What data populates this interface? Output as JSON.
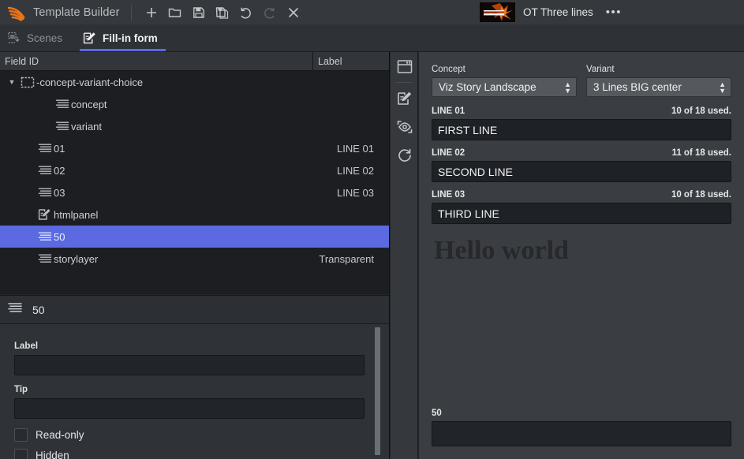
{
  "titlebar": {
    "logo_icon": "vizrt-swoosh-logo",
    "app_title": "Template Builder",
    "buttons": [
      {
        "name": "new",
        "icon": "plus-icon",
        "label": "+",
        "disabled": false
      },
      {
        "name": "open",
        "icon": "folder-open-icon",
        "label": "",
        "disabled": false
      },
      {
        "name": "save",
        "icon": "save-icon",
        "label": "",
        "disabled": false
      },
      {
        "name": "save-as",
        "icon": "save-as-icon",
        "label": "",
        "disabled": false
      },
      {
        "name": "undo",
        "icon": "undo-icon",
        "label": "",
        "disabled": false
      },
      {
        "name": "redo",
        "icon": "redo-icon",
        "label": "",
        "disabled": true
      },
      {
        "name": "close",
        "icon": "close-icon",
        "label": "",
        "disabled": false
      }
    ],
    "document": {
      "thumbnail_icon": "template-thumbnail",
      "name": "OT Three lines",
      "overflow_menu": "•••"
    }
  },
  "tabs": [
    {
      "id": "scenes",
      "label": "Scenes",
      "icon": "scenes-icon",
      "active": false
    },
    {
      "id": "fill-in-form",
      "label": "Fill-in form",
      "icon": "form-edit-icon",
      "active": true
    }
  ],
  "tree": {
    "columns": {
      "field_id": "Field ID",
      "label": "Label"
    },
    "rows": [
      {
        "name": "-concept-variant-choice",
        "label": "",
        "icon": "dashed-box-icon",
        "indent": 0,
        "twisty": "▼",
        "selected": false
      },
      {
        "name": "concept",
        "label": "",
        "icon": "text-lines-icon",
        "indent": 2,
        "twisty": "",
        "selected": false
      },
      {
        "name": "variant",
        "label": "",
        "icon": "text-lines-icon",
        "indent": 2,
        "twisty": "",
        "selected": false
      },
      {
        "name": "01",
        "label": "LINE 01",
        "icon": "text-lines-icon",
        "indent": 1,
        "twisty": "",
        "selected": false
      },
      {
        "name": "02",
        "label": "LINE 02",
        "icon": "text-lines-icon",
        "indent": 1,
        "twisty": "",
        "selected": false
      },
      {
        "name": "03",
        "label": "LINE 03",
        "icon": "text-lines-icon",
        "indent": 1,
        "twisty": "",
        "selected": false
      },
      {
        "name": "htmlpanel",
        "label": "",
        "icon": "html-panel-icon",
        "indent": 1,
        "twisty": "",
        "selected": false
      },
      {
        "name": "50",
        "label": "",
        "icon": "text-lines-icon",
        "indent": 1,
        "twisty": "",
        "selected": true
      },
      {
        "name": "storylayer",
        "label": "Transparent",
        "icon": "text-lines-icon",
        "indent": 1,
        "twisty": "",
        "selected": false
      }
    ]
  },
  "properties": {
    "header_icon": "text-lines-icon",
    "header_name": "50",
    "label_field": {
      "label": "Label",
      "value": "",
      "placeholder": ""
    },
    "tip_field": {
      "label": "Tip",
      "value": "",
      "placeholder": ""
    },
    "checkboxes": [
      {
        "id": "read-only",
        "label": "Read-only",
        "checked": false
      },
      {
        "id": "hidden",
        "label": "Hidden",
        "checked": false
      }
    ]
  },
  "rail": {
    "buttons": [
      {
        "name": "panel-icon",
        "title": "Panel"
      },
      {
        "name": "edit-icon",
        "title": "Edit"
      },
      {
        "name": "preview-eye-icon",
        "title": "Preview"
      },
      {
        "name": "refresh-icon",
        "title": "Refresh"
      }
    ]
  },
  "form": {
    "concept": {
      "label": "Concept",
      "value": "Viz Story Landscape",
      "arrows_icon": "updown-arrows-icon"
    },
    "variant": {
      "label": "Variant",
      "value": "3 Lines BIG center",
      "arrows_icon": "updown-arrows-icon"
    },
    "lines": [
      {
        "name": "LINE 01",
        "used": "10 of 18 used.",
        "value": "FIRST LINE"
      },
      {
        "name": "LINE 02",
        "used": "11 of 18 used.",
        "value": "SECOND LINE"
      },
      {
        "name": "LINE 03",
        "used": "10 of 18 used.",
        "value": "THIRD LINE"
      }
    ],
    "html_preview_text": "Hello world",
    "bottom_field": {
      "label": "50",
      "value": "",
      "placeholder": ""
    }
  },
  "colors": {
    "accent": "#5b6ae0",
    "brand_orange": "#e8751a",
    "titlebar_bg": "#35383c",
    "tree_bg": "#1c1e22",
    "form_bg": "#3a3d42"
  }
}
